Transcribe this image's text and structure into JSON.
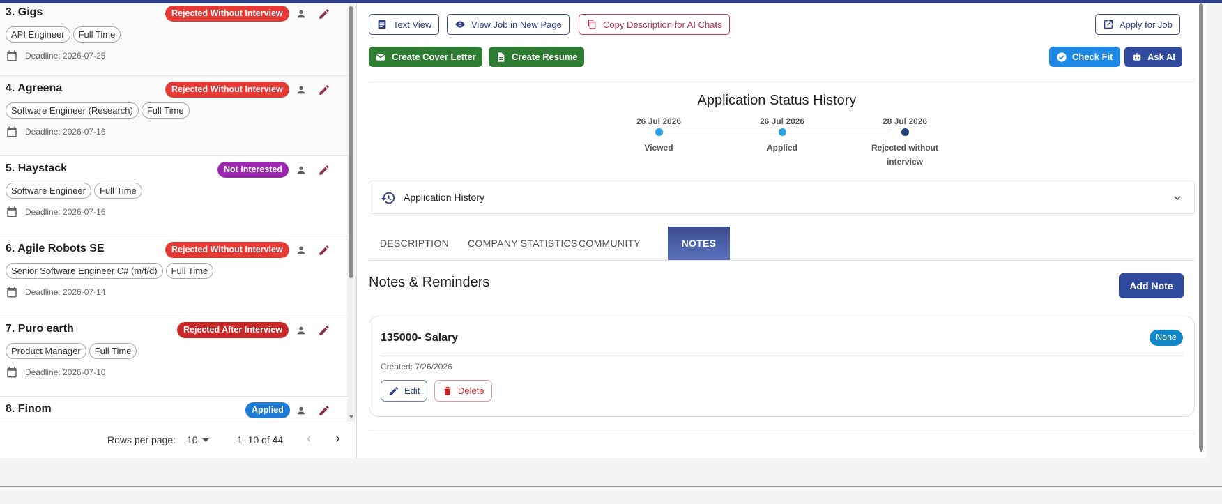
{
  "jobs": [
    {
      "title": "3. Gigs",
      "status": "Rejected Without Interview",
      "tags": [
        "API Engineer",
        "Full Time"
      ],
      "deadline": "Deadline: 2026-07-25"
    },
    {
      "title": "4. Agreena",
      "status": "Rejected Without Interview",
      "tags": [
        "Software Engineer (Research)",
        "Full Time"
      ],
      "deadline": "Deadline: 2026-07-16"
    },
    {
      "title": "5. Haystack",
      "status": "Not Interested",
      "tags": [
        "Software Engineer",
        "Full Time"
      ],
      "deadline": "Deadline: 2026-07-16"
    },
    {
      "title": "6. Agile Robots SE",
      "status": "Rejected Without Interview",
      "tags": [
        "Senior Software Engineer C# (m/f/d)",
        "Full Time"
      ],
      "deadline": "Deadline: 2026-07-14"
    },
    {
      "title": "7. Puro earth",
      "status": "Rejected After Interview",
      "tags": [
        "Product Manager",
        "Full Time"
      ],
      "deadline": "Deadline: 2026-07-10"
    },
    {
      "title": "8. Finom",
      "status": "Applied",
      "tags": [],
      "deadline": ""
    }
  ],
  "pagination": {
    "rows_label": "Rows per page:",
    "rows_value": "10",
    "range": "1–10 of 44"
  },
  "toolbar": {
    "text_view": "Text View",
    "view_job": "View Job in New Page",
    "copy_desc": "Copy Description for AI Chats",
    "apply": "Apply for Job",
    "cover_letter": "Create Cover Letter",
    "resume": "Create Resume",
    "check_fit": "Check Fit",
    "ask_ai": "Ask AI"
  },
  "history": {
    "title": "Application Status History",
    "steps": [
      {
        "date": "26 Jul 2026",
        "label": "Viewed"
      },
      {
        "date": "26 Jul 2026",
        "label": "Applied"
      },
      {
        "date": "28 Jul 2026",
        "label": "Rejected without interview"
      }
    ],
    "accordion_label": "Application History"
  },
  "tabs": [
    "DESCRIPTION",
    "COMPANY STATISTICS",
    "COMMUNITY",
    "NOTES"
  ],
  "notes": {
    "title": "Notes & Reminders",
    "add_label": "Add Note",
    "items": [
      {
        "title": "135000- Salary",
        "badge": "None",
        "created": "Created: 7/26/2026",
        "edit": "Edit",
        "delete": "Delete"
      }
    ]
  },
  "colors": {
    "accent": "#2c3e86",
    "green": "#2e7d32",
    "rejected": "#e53935",
    "not_interested": "#9c27b0",
    "applied": "#1e7bd6",
    "check_fit": "#1e88e5"
  }
}
